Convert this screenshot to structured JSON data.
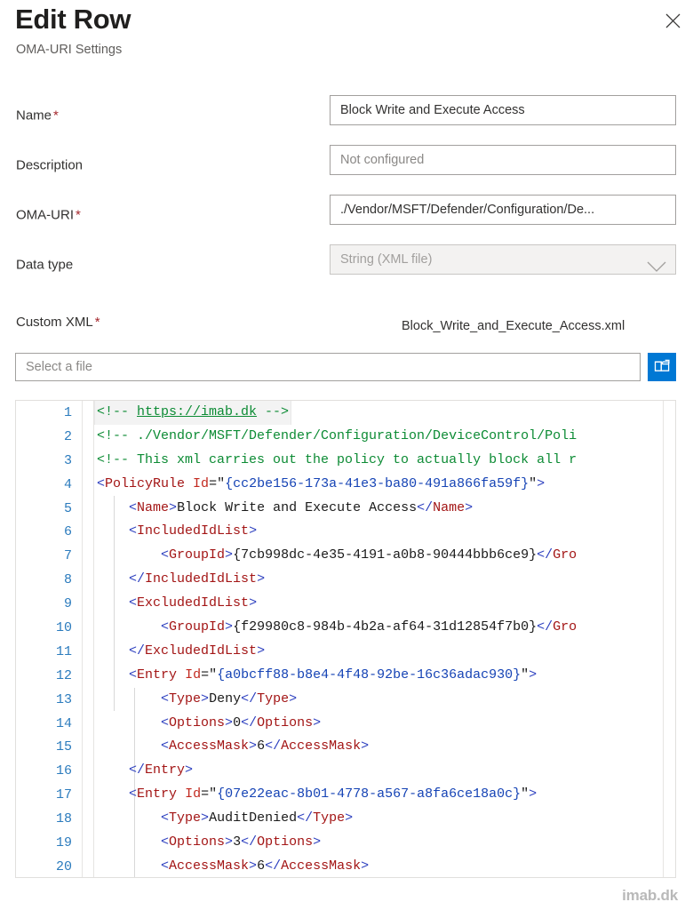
{
  "header": {
    "title": "Edit Row",
    "subtitle": "OMA-URI Settings",
    "close_label": "Close"
  },
  "form": {
    "fields": [
      {
        "label": "Name",
        "required": true,
        "value": "Block Write and Execute Access",
        "is_placeholder": false,
        "type": "text",
        "disabled": false
      },
      {
        "label": "Description",
        "required": false,
        "value": "Not configured",
        "is_placeholder": true,
        "type": "text",
        "disabled": false
      },
      {
        "label": "OMA-URI",
        "required": true,
        "value": "./Vendor/MSFT/Defender/Configuration/De...",
        "is_placeholder": false,
        "type": "text",
        "disabled": false
      },
      {
        "label": "Data type",
        "required": false,
        "value": "String (XML file)",
        "is_placeholder": true,
        "type": "dropdown",
        "disabled": true
      }
    ]
  },
  "custom_xml": {
    "label": "Custom XML",
    "required": true,
    "filename": "Block_Write_and_Execute_Access.xml",
    "file_input_placeholder": "Select a file",
    "browse_button_label": "Browse for file"
  },
  "code": {
    "language": "xml",
    "highlighted_line": 1,
    "lines": [
      {
        "n": 1,
        "tokens": [
          {
            "t": "<!-- ",
            "c": "comment"
          },
          {
            "t": "https://imab.dk",
            "c": "link"
          },
          {
            "t": " -->",
            "c": "comment"
          }
        ]
      },
      {
        "n": 2,
        "tokens": [
          {
            "t": "<!-- ./Vendor/MSFT/Defender/Configuration/DeviceControl/Poli",
            "c": "comment"
          }
        ]
      },
      {
        "n": 3,
        "tokens": [
          {
            "t": "<!-- This xml carries out the policy to actually block all r",
            "c": "comment"
          }
        ]
      },
      {
        "n": 4,
        "tokens": [
          {
            "t": "<",
            "c": "bracket"
          },
          {
            "t": "PolicyRule",
            "c": "tag"
          },
          {
            "t": " ",
            "c": "text"
          },
          {
            "t": "Id",
            "c": "attr"
          },
          {
            "t": "=\"",
            "c": "text"
          },
          {
            "t": "{cc2be156-173a-41e3-ba80-491a866fa59f}",
            "c": "value"
          },
          {
            "t": "\"",
            "c": "text"
          },
          {
            "t": ">",
            "c": "bracket"
          }
        ]
      },
      {
        "n": 5,
        "tokens": [
          {
            "t": "    ",
            "c": "text"
          },
          {
            "t": "<",
            "c": "bracket"
          },
          {
            "t": "Name",
            "c": "tag"
          },
          {
            "t": ">",
            "c": "bracket"
          },
          {
            "t": "Block Write and Execute Access",
            "c": "text"
          },
          {
            "t": "</",
            "c": "bracket"
          },
          {
            "t": "Name",
            "c": "tag"
          },
          {
            "t": ">",
            "c": "bracket"
          }
        ]
      },
      {
        "n": 6,
        "tokens": [
          {
            "t": "    ",
            "c": "text"
          },
          {
            "t": "<",
            "c": "bracket"
          },
          {
            "t": "IncludedIdList",
            "c": "tag"
          },
          {
            "t": ">",
            "c": "bracket"
          }
        ]
      },
      {
        "n": 7,
        "tokens": [
          {
            "t": "        ",
            "c": "text"
          },
          {
            "t": "<",
            "c": "bracket"
          },
          {
            "t": "GroupId",
            "c": "tag"
          },
          {
            "t": ">",
            "c": "bracket"
          },
          {
            "t": "{7cb998dc-4e35-4191-a0b8-90444bbb6ce9}",
            "c": "text"
          },
          {
            "t": "</",
            "c": "bracket"
          },
          {
            "t": "Gro",
            "c": "tag"
          }
        ]
      },
      {
        "n": 8,
        "tokens": [
          {
            "t": "    ",
            "c": "text"
          },
          {
            "t": "</",
            "c": "bracket"
          },
          {
            "t": "IncludedIdList",
            "c": "tag"
          },
          {
            "t": ">",
            "c": "bracket"
          }
        ]
      },
      {
        "n": 9,
        "tokens": [
          {
            "t": "    ",
            "c": "text"
          },
          {
            "t": "<",
            "c": "bracket"
          },
          {
            "t": "ExcludedIdList",
            "c": "tag"
          },
          {
            "t": ">",
            "c": "bracket"
          }
        ]
      },
      {
        "n": 10,
        "tokens": [
          {
            "t": "        ",
            "c": "text"
          },
          {
            "t": "<",
            "c": "bracket"
          },
          {
            "t": "GroupId",
            "c": "tag"
          },
          {
            "t": ">",
            "c": "bracket"
          },
          {
            "t": "{f29980c8-984b-4b2a-af64-31d12854f7b0}",
            "c": "text"
          },
          {
            "t": "</",
            "c": "bracket"
          },
          {
            "t": "Gro",
            "c": "tag"
          }
        ]
      },
      {
        "n": 11,
        "tokens": [
          {
            "t": "    ",
            "c": "text"
          },
          {
            "t": "</",
            "c": "bracket"
          },
          {
            "t": "ExcludedIdList",
            "c": "tag"
          },
          {
            "t": ">",
            "c": "bracket"
          }
        ]
      },
      {
        "n": 12,
        "tokens": [
          {
            "t": "    ",
            "c": "text"
          },
          {
            "t": "<",
            "c": "bracket"
          },
          {
            "t": "Entry",
            "c": "tag"
          },
          {
            "t": " ",
            "c": "text"
          },
          {
            "t": "Id",
            "c": "attr"
          },
          {
            "t": "=\"",
            "c": "text"
          },
          {
            "t": "{a0bcff88-b8e4-4f48-92be-16c36adac930}",
            "c": "value"
          },
          {
            "t": "\"",
            "c": "text"
          },
          {
            "t": ">",
            "c": "bracket"
          }
        ]
      },
      {
        "n": 13,
        "tokens": [
          {
            "t": "        ",
            "c": "text"
          },
          {
            "t": "<",
            "c": "bracket"
          },
          {
            "t": "Type",
            "c": "tag"
          },
          {
            "t": ">",
            "c": "bracket"
          },
          {
            "t": "Deny",
            "c": "text"
          },
          {
            "t": "</",
            "c": "bracket"
          },
          {
            "t": "Type",
            "c": "tag"
          },
          {
            "t": ">",
            "c": "bracket"
          }
        ]
      },
      {
        "n": 14,
        "tokens": [
          {
            "t": "        ",
            "c": "text"
          },
          {
            "t": "<",
            "c": "bracket"
          },
          {
            "t": "Options",
            "c": "tag"
          },
          {
            "t": ">",
            "c": "bracket"
          },
          {
            "t": "0",
            "c": "text"
          },
          {
            "t": "</",
            "c": "bracket"
          },
          {
            "t": "Options",
            "c": "tag"
          },
          {
            "t": ">",
            "c": "bracket"
          }
        ]
      },
      {
        "n": 15,
        "tokens": [
          {
            "t": "        ",
            "c": "text"
          },
          {
            "t": "<",
            "c": "bracket"
          },
          {
            "t": "AccessMask",
            "c": "tag"
          },
          {
            "t": ">",
            "c": "bracket"
          },
          {
            "t": "6",
            "c": "text"
          },
          {
            "t": "</",
            "c": "bracket"
          },
          {
            "t": "AccessMask",
            "c": "tag"
          },
          {
            "t": ">",
            "c": "bracket"
          }
        ]
      },
      {
        "n": 16,
        "tokens": [
          {
            "t": "    ",
            "c": "text"
          },
          {
            "t": "</",
            "c": "bracket"
          },
          {
            "t": "Entry",
            "c": "tag"
          },
          {
            "t": ">",
            "c": "bracket"
          }
        ]
      },
      {
        "n": 17,
        "tokens": [
          {
            "t": "    ",
            "c": "text"
          },
          {
            "t": "<",
            "c": "bracket"
          },
          {
            "t": "Entry",
            "c": "tag"
          },
          {
            "t": " ",
            "c": "text"
          },
          {
            "t": "Id",
            "c": "attr"
          },
          {
            "t": "=\"",
            "c": "text"
          },
          {
            "t": "{07e22eac-8b01-4778-a567-a8fa6ce18a0c}",
            "c": "value"
          },
          {
            "t": "\"",
            "c": "text"
          },
          {
            "t": ">",
            "c": "bracket"
          }
        ]
      },
      {
        "n": 18,
        "tokens": [
          {
            "t": "        ",
            "c": "text"
          },
          {
            "t": "<",
            "c": "bracket"
          },
          {
            "t": "Type",
            "c": "tag"
          },
          {
            "t": ">",
            "c": "bracket"
          },
          {
            "t": "AuditDenied",
            "c": "text"
          },
          {
            "t": "</",
            "c": "bracket"
          },
          {
            "t": "Type",
            "c": "tag"
          },
          {
            "t": ">",
            "c": "bracket"
          }
        ]
      },
      {
        "n": 19,
        "tokens": [
          {
            "t": "        ",
            "c": "text"
          },
          {
            "t": "<",
            "c": "bracket"
          },
          {
            "t": "Options",
            "c": "tag"
          },
          {
            "t": ">",
            "c": "bracket"
          },
          {
            "t": "3",
            "c": "text"
          },
          {
            "t": "</",
            "c": "bracket"
          },
          {
            "t": "Options",
            "c": "tag"
          },
          {
            "t": ">",
            "c": "bracket"
          }
        ]
      },
      {
        "n": 20,
        "tokens": [
          {
            "t": "        ",
            "c": "text"
          },
          {
            "t": "<",
            "c": "bracket"
          },
          {
            "t": "AccessMask",
            "c": "tag"
          },
          {
            "t": ">",
            "c": "bracket"
          },
          {
            "t": "6",
            "c": "text"
          },
          {
            "t": "</",
            "c": "bracket"
          },
          {
            "t": "AccessMask",
            "c": "tag"
          },
          {
            "t": ">",
            "c": "bracket"
          }
        ]
      }
    ]
  },
  "watermark": {
    "text": "imab.dk"
  },
  "colors": {
    "accent": "#0078d4",
    "required_star": "#a4262c",
    "comment": "#0c8b34",
    "tag": "#a31515",
    "bracket": "#2c3fbf",
    "attribute": "#c2291f",
    "attribute_value": "#1543b5",
    "line_number": "#2b7bbd"
  }
}
